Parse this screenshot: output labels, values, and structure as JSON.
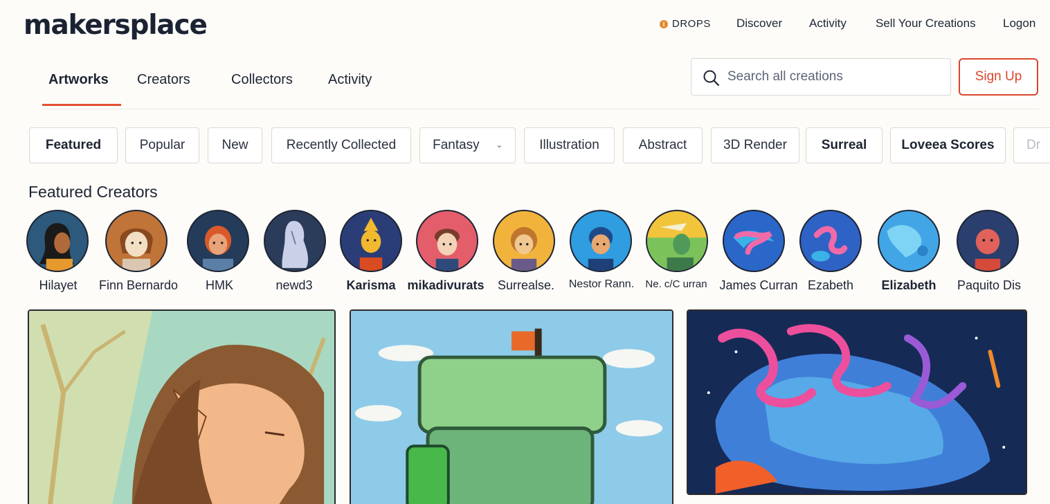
{
  "brand": {
    "name": "makersplace"
  },
  "topnav": {
    "drops": "DROPS",
    "discover": "Discover",
    "activity": "Activity",
    "sell": "Sell Your Creations",
    "logon": "Logon"
  },
  "tabs": [
    "Artworks",
    "Creators",
    "Collectors",
    "Activity"
  ],
  "search": {
    "placeholder": "Search all creations",
    "value": ""
  },
  "signup_label": "Sign Up",
  "filters": [
    "Featured",
    "Popular",
    "New",
    "Recently Collected",
    "Fantasy",
    "Illustration",
    "Abstract",
    "3D Render",
    "Surreal",
    "Loveea Scores",
    "Dr"
  ],
  "section_title": "Featured Creators",
  "creators": [
    "Hilayet",
    "Finn Bernardo",
    "HMK",
    "newd3",
    "Karisma",
    "mikadivurats",
    "Surrealse.",
    "Nestor Rann.",
    "Ne. c/C urran",
    "James Curran",
    "Ezabeth",
    "Elizabeth",
    "Paquito Dis"
  ],
  "colors": {
    "accent": "#d9462b",
    "text": "#1e2433",
    "background": "#fdfcf9"
  }
}
